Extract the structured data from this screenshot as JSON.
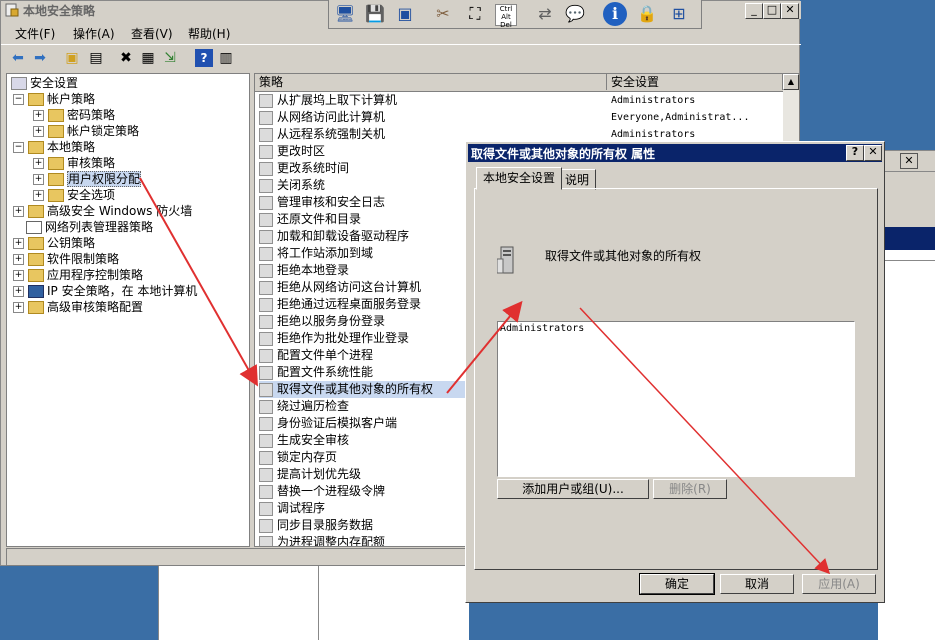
{
  "main_window": {
    "title": "本地安全策略",
    "menu": [
      "文件(F)",
      "操作(A)",
      "查看(V)",
      "帮助(H)"
    ]
  },
  "tree": {
    "root": "安全设置",
    "items": [
      {
        "label": "帐户策略",
        "level": 1,
        "expanded": true
      },
      {
        "label": "密码策略",
        "level": 2,
        "expanded": false
      },
      {
        "label": "帐户锁定策略",
        "level": 2,
        "expanded": false
      },
      {
        "label": "本地策略",
        "level": 1,
        "expanded": true
      },
      {
        "label": "审核策略",
        "level": 2,
        "expanded": false
      },
      {
        "label": "用户权限分配",
        "level": 2,
        "expanded": false,
        "selected": true
      },
      {
        "label": "安全选项",
        "level": 2,
        "expanded": false
      },
      {
        "label": "高级安全 Windows 防火墙",
        "level": 1,
        "expanded": false
      },
      {
        "label": "网络列表管理器策略",
        "level": 1,
        "expanded": null
      },
      {
        "label": "公钥策略",
        "level": 1,
        "expanded": false
      },
      {
        "label": "软件限制策略",
        "level": 1,
        "expanded": false
      },
      {
        "label": "应用程序控制策略",
        "level": 1,
        "expanded": false
      },
      {
        "label": "IP 安全策略，在 本地计算机",
        "level": 1,
        "expanded": false
      },
      {
        "label": "高级审核策略配置",
        "level": 1,
        "expanded": false
      }
    ]
  },
  "list": {
    "col_policy": "策略",
    "col_setting": "安全设置",
    "rows": [
      {
        "policy": "从扩展坞上取下计算机",
        "setting": "Administrators"
      },
      {
        "policy": "从网络访问此计算机",
        "setting": "Everyone,Administrat..."
      },
      {
        "policy": "从远程系统强制关机",
        "setting": "Administrators"
      },
      {
        "policy": "更改时区",
        "setting": ""
      },
      {
        "policy": "更改系统时间",
        "setting": ""
      },
      {
        "policy": "关闭系统",
        "setting": ""
      },
      {
        "policy": "管理审核和安全日志",
        "setting": ""
      },
      {
        "policy": "还原文件和目录",
        "setting": ""
      },
      {
        "policy": "加载和卸载设备驱动程序",
        "setting": ""
      },
      {
        "policy": "将工作站添加到域",
        "setting": ""
      },
      {
        "policy": "拒绝本地登录",
        "setting": ""
      },
      {
        "policy": "拒绝从网络访问这台计算机",
        "setting": ""
      },
      {
        "policy": "拒绝通过远程桌面服务登录",
        "setting": ""
      },
      {
        "policy": "拒绝以服务身份登录",
        "setting": ""
      },
      {
        "policy": "拒绝作为批处理作业登录",
        "setting": ""
      },
      {
        "policy": "配置文件单个进程",
        "setting": ""
      },
      {
        "policy": "配置文件系统性能",
        "setting": ""
      },
      {
        "policy": "取得文件或其他对象的所有权",
        "setting": "",
        "selected": true
      },
      {
        "policy": "绕过遍历检查",
        "setting": ""
      },
      {
        "policy": "身份验证后模拟客户端",
        "setting": ""
      },
      {
        "policy": "生成安全审核",
        "setting": ""
      },
      {
        "policy": "锁定内存页",
        "setting": ""
      },
      {
        "policy": "提高计划优先级",
        "setting": ""
      },
      {
        "policy": "替换一个进程级令牌",
        "setting": ""
      },
      {
        "policy": "调试程序",
        "setting": ""
      },
      {
        "policy": "同步目录服务数据",
        "setting": ""
      },
      {
        "policy": "为进程调整内存配额",
        "setting": ""
      }
    ]
  },
  "dialog": {
    "title": "取得文件或其他对象的所有权 属性",
    "tabs": [
      "本地安全设置",
      "说明"
    ],
    "active_tab": "本地安全设置",
    "heading": "取得文件或其他对象的所有权",
    "accounts": [
      "Administrators"
    ],
    "add_button": "添加用户或组(U)...",
    "remove_button": "删除(R)",
    "ok_button": "确定",
    "cancel_button": "取消",
    "apply_button": "应用(A)"
  },
  "colors": {
    "dialog_title_bg": "#0a246a",
    "annotation_arrow": "#e03030",
    "selection": "#c8d8f0"
  },
  "icons": {
    "mini_toolbar": [
      "computer-monitor-icon",
      "save-icon",
      "remote-computer-icon",
      "tools-icon",
      "fullscreen-icon",
      "ctrl-alt-del-icon",
      "switch-arrows-icon",
      "chat-bubble-icon",
      "info-icon",
      "lock-icon",
      "network-icon"
    ]
  }
}
